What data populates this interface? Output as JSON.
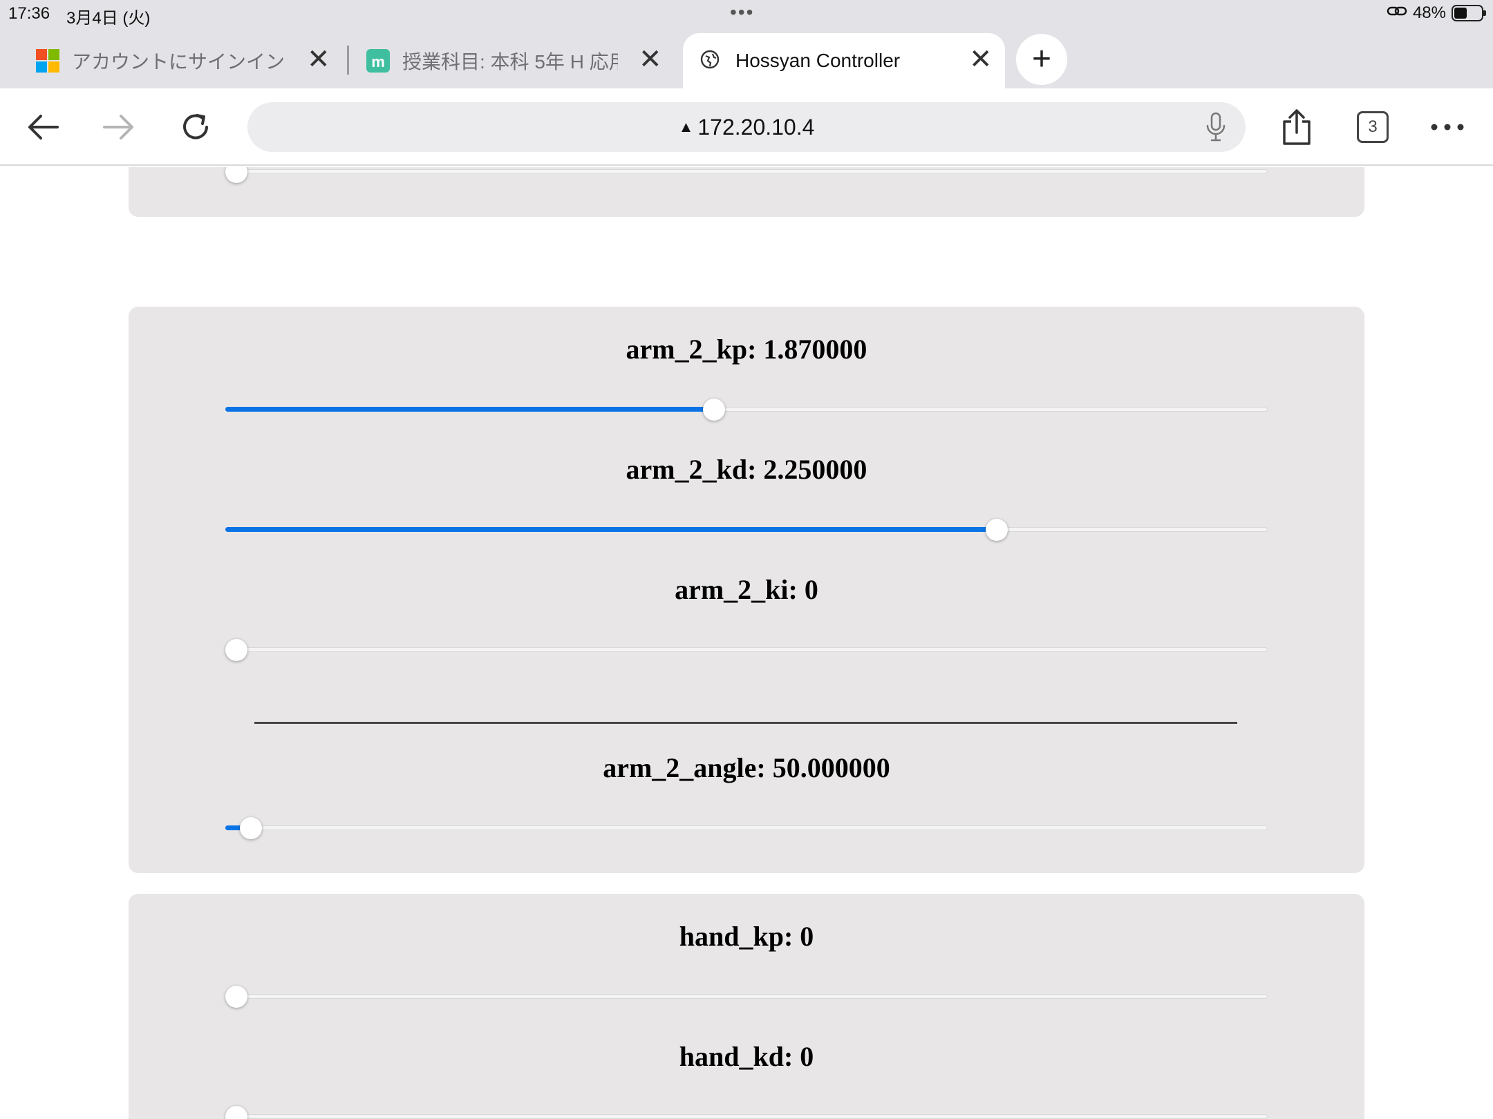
{
  "status_bar": {
    "time": "17:36",
    "date": "3月4日 (火)",
    "battery_percent": "48%",
    "battery_level": 0.48
  },
  "tabs": [
    {
      "title": "アカウントにサインイン",
      "icon": "microsoft-logo-icon",
      "active": false
    },
    {
      "title": "授業科目: 本科 5年 H 応用",
      "icon": "moodle-icon",
      "active": false
    },
    {
      "title": "Hossyan Controller",
      "icon": "globe-icon",
      "active": true
    }
  ],
  "toolbar": {
    "url": "172.20.10.4",
    "security_icon": "warning-icon",
    "tab_count": "3"
  },
  "panels": [
    {
      "sliders": [
        {
          "label": "",
          "value_fraction": 0.0
        }
      ]
    },
    {
      "sliders": [
        {
          "label": "arm_2_kp: 1.870000",
          "value_fraction": 0.468
        },
        {
          "label": "arm_2_kd: 2.250000",
          "value_fraction": 0.745
        },
        {
          "label": "arm_2_ki: 0",
          "value_fraction": 0.0
        },
        {
          "label": "arm_2_angle: 50.000000",
          "value_fraction": 0.014
        }
      ]
    },
    {
      "sliders": [
        {
          "label": "hand_kp: 0",
          "value_fraction": 0.0
        },
        {
          "label": "hand_kd: 0",
          "value_fraction": 0.0
        }
      ]
    }
  ],
  "colors": {
    "accent": "#0a74e6",
    "panel_bg": "#e8e6e7",
    "chrome_bg": "#e3e3e7"
  }
}
